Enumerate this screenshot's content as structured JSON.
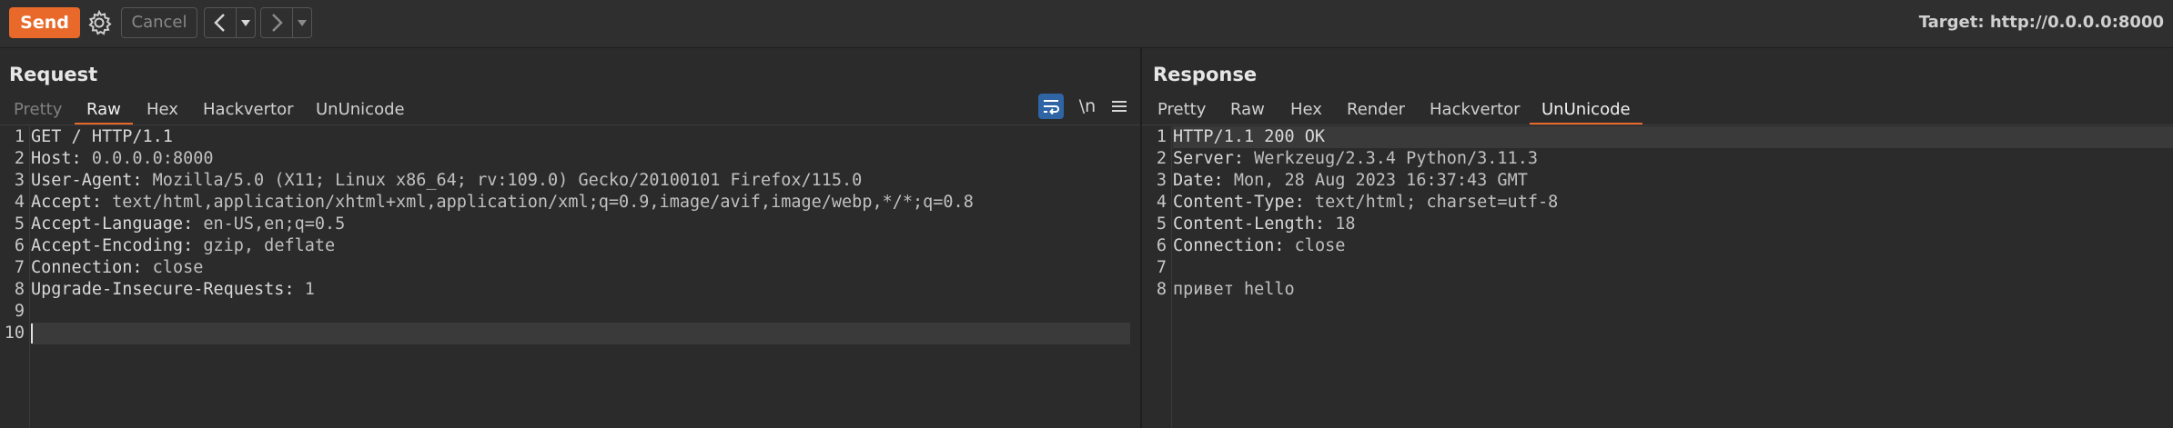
{
  "toolbar": {
    "send_label": "Send",
    "cancel_label": "Cancel",
    "target_label": "Target: http://0.0.0.0:8000"
  },
  "request": {
    "title": "Request",
    "tabs": [
      "Pretty",
      "Raw",
      "Hex",
      "Hackvertor",
      "UnUnicode"
    ],
    "active_tab": "Raw",
    "toolbar_icons": [
      "wrap-lines-icon",
      "newline-toggle-icon",
      "menu-icon"
    ],
    "newline_label": "\\n",
    "lines": [
      {
        "n": "1",
        "name": "GET / HTTP/1.1",
        "value": ""
      },
      {
        "n": "2",
        "name": "Host:",
        "value": " 0.0.0.0:8000"
      },
      {
        "n": "3",
        "name": "User-Agent:",
        "value": " Mozilla/5.0 (X11; Linux x86_64; rv:109.0) Gecko/20100101 Firefox/115.0"
      },
      {
        "n": "4",
        "name": "Accept:",
        "value": " text/html,application/xhtml+xml,application/xml;q=0.9,image/avif,image/webp,*/*;q=0.8"
      },
      {
        "n": "5",
        "name": "Accept-Language:",
        "value": " en-US,en;q=0.5"
      },
      {
        "n": "6",
        "name": "Accept-Encoding:",
        "value": " gzip, deflate"
      },
      {
        "n": "7",
        "name": "Connection:",
        "value": " close"
      },
      {
        "n": "8",
        "name": "Upgrade-Insecure-Requests:",
        "value": " 1"
      },
      {
        "n": "9",
        "name": "",
        "value": ""
      },
      {
        "n": "10",
        "name": "",
        "value": ""
      }
    ]
  },
  "response": {
    "title": "Response",
    "tabs": [
      "Pretty",
      "Raw",
      "Hex",
      "Render",
      "Hackvertor",
      "UnUnicode"
    ],
    "active_tab": "UnUnicode",
    "lines": [
      {
        "n": "1",
        "name": "HTTP/1.1 200 OK",
        "value": ""
      },
      {
        "n": "2",
        "name": "Server:",
        "value": " Werkzeug/2.3.4 Python/3.11.3"
      },
      {
        "n": "3",
        "name": "Date:",
        "value": " Mon, 28 Aug 2023 16:37:43 GMT"
      },
      {
        "n": "4",
        "name": "Content-Type:",
        "value": " text/html; charset=utf-8"
      },
      {
        "n": "5",
        "name": "Content-Length:",
        "value": " 18"
      },
      {
        "n": "6",
        "name": "Connection:",
        "value": " close"
      },
      {
        "n": "7",
        "name": "",
        "value": ""
      },
      {
        "n": "8",
        "name": "привет hello",
        "value": ""
      }
    ]
  },
  "colors": {
    "accent": "#e8692a",
    "background": "#2b2b2b",
    "toggle_blue": "#2f65a5"
  }
}
